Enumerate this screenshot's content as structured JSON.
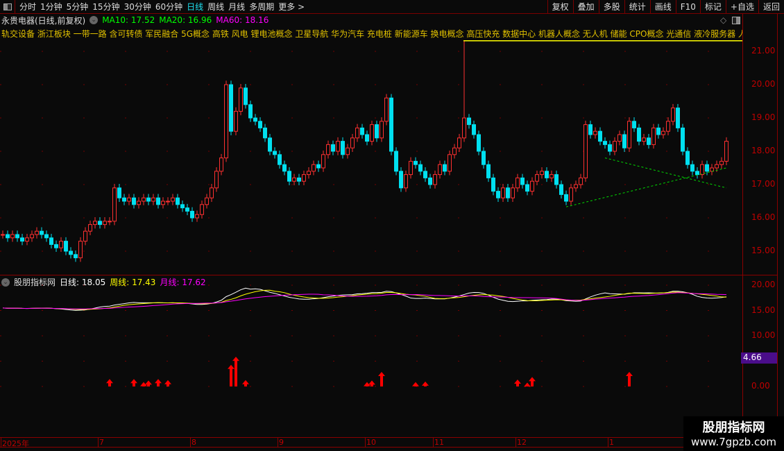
{
  "toolbar": {
    "periods": [
      "分时",
      "1分钟",
      "5分钟",
      "15分钟",
      "30分钟",
      "60分钟",
      "日线",
      "周线",
      "月线",
      "多周期",
      "更多 >"
    ],
    "active": "日线",
    "buttons": [
      "复权",
      "叠加",
      "多股",
      "统计",
      "画线",
      "F10",
      "标记",
      "+自选",
      "返回"
    ]
  },
  "info": {
    "stock": "永贵电器(日线,前复权)",
    "ma10": "MA10: 17.52",
    "ma20": "MA20: 16.96",
    "ma60": "MA60: 18.16"
  },
  "concepts": "轨交设备 浙江板块 一带一路 含可转债 军民融合 5G概念 高铁 风电 锂电池概念 卫星导航 华为汽车 充电桩 新能源车 换电概念 高压快充 数据中心 机器人概念 无人机 储能 CPO概念 光通信 液冷服务器 人形",
  "indicator": {
    "name": "股朋指标网",
    "day": "日线: 18.05",
    "week": "周线: 17.43",
    "month": "月线: 17.62",
    "marker": "4.66"
  },
  "watermark": {
    "line1": "股朋指标网",
    "line2": "www.7gpzb.com"
  },
  "colors": {
    "up": "#ff3030",
    "down": "#00e0f0",
    "ma_day": "#ffffff",
    "ma_week": "#ffff00",
    "ma_month": "#ff00ff",
    "signal": "#ff0000",
    "trendline": "#00dd00"
  },
  "chart_data": [
    {
      "type": "candlestick",
      "ylim": [
        14.6,
        21.8
      ],
      "yticks": [
        "21.00",
        "20.00",
        "19.00",
        "18.00",
        "17.00",
        "16.00",
        "15.00"
      ],
      "closes": [
        15.5,
        15.4,
        15.5,
        15.4,
        15.3,
        15.4,
        15.5,
        15.6,
        15.5,
        15.4,
        15.2,
        15.1,
        15.3,
        15.0,
        14.9,
        14.8,
        15.3,
        15.6,
        15.8,
        15.9,
        15.8,
        15.9,
        15.9,
        16.9,
        16.6,
        16.5,
        16.6,
        16.4,
        16.5,
        16.6,
        16.5,
        16.6,
        16.4,
        16.5,
        16.5,
        16.6,
        16.4,
        16.3,
        16.2,
        16.0,
        16.1,
        16.4,
        16.6,
        16.9,
        17.4,
        17.8,
        20.0,
        18.6,
        19.2,
        19.9,
        19.4,
        19.0,
        18.9,
        18.7,
        18.4,
        18.0,
        17.9,
        17.6,
        17.4,
        17.1,
        17.2,
        17.1,
        17.3,
        17.4,
        17.6,
        17.5,
        17.9,
        18.2,
        18.0,
        18.3,
        17.9,
        18.1,
        18.4,
        18.7,
        18.5,
        18.3,
        18.8,
        18.4,
        18.9,
        19.6,
        18.0,
        17.4,
        16.9,
        17.3,
        17.7,
        17.6,
        17.4,
        17.2,
        17.0,
        17.3,
        17.6,
        17.4,
        17.9,
        18.1,
        18.4,
        19.0,
        18.8,
        18.5,
        18.0,
        17.6,
        17.2,
        16.8,
        16.6,
        16.9,
        16.6,
        16.9,
        17.2,
        17.0,
        16.8,
        17.1,
        17.3,
        17.4,
        17.2,
        17.3,
        17.0,
        16.7,
        16.5,
        16.9,
        17.0,
        17.2,
        18.8,
        18.5,
        18.6,
        18.3,
        18.2,
        18.0,
        18.3,
        18.5,
        18.1,
        18.9,
        18.7,
        18.3,
        18.4,
        18.2,
        18.7,
        18.5,
        18.6,
        18.9,
        19.3,
        18.7,
        18.0,
        17.6,
        17.4,
        17.3,
        17.6,
        17.4,
        17.5,
        17.6,
        17.7,
        18.3
      ],
      "spike_high": {
        "index": 95,
        "value": 21.7
      },
      "xticks": [
        {
          "index": 0,
          "label": "2025年"
        },
        {
          "index": 20,
          "label": "7"
        },
        {
          "index": 39,
          "label": "8"
        },
        {
          "index": 57,
          "label": "9"
        },
        {
          "index": 75,
          "label": "10"
        },
        {
          "index": 89,
          "label": "11"
        },
        {
          "index": 106,
          "label": "12"
        },
        {
          "index": 125,
          "label": "1"
        }
      ],
      "trendlines": [
        {
          "from": [
            116,
            16.33
          ],
          "to": [
            149,
            17.5
          ]
        },
        {
          "from": [
            124,
            17.8
          ],
          "to": [
            149,
            16.9
          ]
        }
      ]
    },
    {
      "type": "line+signal",
      "ylim": [
        -2,
        22
      ],
      "yticks": [
        "20.00",
        "15.00",
        "10.00",
        "5.00",
        "0.00"
      ],
      "signals": [
        {
          "index": 22,
          "value": 1.2
        },
        {
          "index": 27,
          "value": 1.2
        },
        {
          "index": 29,
          "value": 0.6
        },
        {
          "index": 30,
          "value": 0.9
        },
        {
          "index": 32,
          "value": 1.2
        },
        {
          "index": 34,
          "value": 1.0
        },
        {
          "index": 47,
          "value": 4.0
        },
        {
          "index": 48,
          "value": 5.6
        },
        {
          "index": 50,
          "value": 1.0
        },
        {
          "index": 75,
          "value": 0.6
        },
        {
          "index": 76,
          "value": 0.9
        },
        {
          "index": 78,
          "value": 2.6
        },
        {
          "index": 85,
          "value": 0.6
        },
        {
          "index": 87,
          "value": 0.7
        },
        {
          "index": 106,
          "value": 1.1
        },
        {
          "index": 108,
          "value": 0.5
        },
        {
          "index": 109,
          "value": 1.6
        },
        {
          "index": 129,
          "value": 2.6
        }
      ]
    }
  ]
}
